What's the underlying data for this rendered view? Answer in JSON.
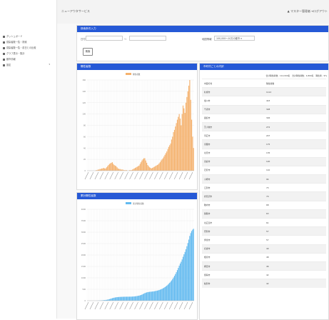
{
  "app": {
    "brand": "ニューアウタサービス",
    "user": "マスター管理者",
    "logout": "ログアウト"
  },
  "sidebar": {
    "items": [
      {
        "icon": "dashboard-icon",
        "label": "ダッシュボード"
      },
      {
        "icon": "file-icon",
        "label": "感染者数一覧・検索"
      },
      {
        "icon": "file-icon",
        "label": "感染者数一覧・前日との比較"
      },
      {
        "icon": "chart-icon",
        "label": "グラフ表示・集計"
      },
      {
        "icon": "list-icon",
        "label": "都市情報"
      },
      {
        "icon": "gear-icon",
        "label": "設定"
      }
    ]
  },
  "search": {
    "title": "検索条件入力",
    "date_label": "日付",
    "range_sep": "〜",
    "filter_label": "地図情報",
    "filter_value": "100,000～10万の都市",
    "search_button": "検索"
  },
  "chart1": {
    "title": "陽性者数",
    "legend": "陽性者数"
  },
  "chart2": {
    "title": "累計陽性者数",
    "legend": "累計陽性者数"
  },
  "city_panel": {
    "title": "市町村ごとの内訳",
    "summary": "合計陽性者数：112,000名　合計陽性者数：4,800名　陽性率：9%",
    "header_city": "市区町村",
    "header_count": "陽性者数",
    "rows": [
      {
        "city": "札幌市",
        "count": "1112"
      },
      {
        "city": "旭川市",
        "count": "443"
      },
      {
        "city": "千歳市",
        "count": "328"
      },
      {
        "city": "函館市",
        "count": "326"
      },
      {
        "city": "苫小牧市",
        "count": "272"
      },
      {
        "city": "帯広市",
        "count": "247"
      },
      {
        "city": "室蘭市",
        "count": "175"
      },
      {
        "city": "北見市",
        "count": "135"
      },
      {
        "city": "恵庭市",
        "count": "120"
      },
      {
        "city": "石狩市",
        "count": "110"
      },
      {
        "city": "小樽市",
        "count": "94"
      },
      {
        "city": "江別市",
        "count": "73"
      },
      {
        "city": "岩見沢市",
        "count": "70"
      },
      {
        "city": "稚内市",
        "count": "68"
      },
      {
        "city": "釧路市",
        "count": "63"
      },
      {
        "city": "北広島市",
        "count": "61"
      },
      {
        "city": "登別市",
        "count": "57"
      },
      {
        "city": "伊達市",
        "count": "57"
      },
      {
        "city": "名寄市",
        "count": "49"
      },
      {
        "city": "根室市",
        "count": "48"
      },
      {
        "city": "網走市",
        "count": "46"
      },
      {
        "city": "留萌市",
        "count": "42"
      },
      {
        "city": "紋別市",
        "count": "42"
      }
    ]
  },
  "colors": {
    "header": "#2659d6",
    "bar_orange": "#f5b26e",
    "bar_blue": "#62baf0"
  },
  "chart_data": [
    {
      "type": "bar",
      "title": "陽性者数",
      "series": [
        {
          "name": "陽性者数",
          "values": [
            0,
            0,
            0,
            0,
            0,
            0,
            0,
            0,
            0,
            1,
            1,
            2,
            2,
            3,
            3,
            4,
            4,
            5,
            4,
            4,
            6,
            8,
            10,
            12,
            13,
            14,
            15,
            12,
            10,
            9,
            8,
            6,
            4,
            3,
            3,
            2,
            2,
            2,
            1,
            1,
            1,
            1,
            0,
            0,
            1,
            1,
            1,
            2,
            3,
            4,
            5,
            6,
            7,
            8,
            9,
            12,
            15,
            18,
            20,
            22,
            22,
            18,
            14,
            10,
            8,
            6,
            5,
            4,
            5,
            6,
            7,
            8,
            9,
            10,
            11,
            13,
            15,
            18,
            20,
            22,
            25,
            28,
            31,
            34,
            38,
            42,
            45,
            48,
            55,
            60,
            68,
            72,
            78,
            84,
            90,
            95,
            100,
            92,
            80,
            100,
            115,
            110,
            102,
            120,
            130,
            140,
            150,
            160,
            125,
            90,
            60,
            40
          ]
        }
      ],
      "ylim": [
        0,
        160
      ],
      "yticks": [
        "0",
        "20",
        "40",
        "60",
        "80",
        "100",
        "120",
        "140",
        "160"
      ]
    },
    {
      "type": "bar",
      "title": "累計陽性者数",
      "series": [
        {
          "name": "累計陽性者数",
          "values": [
            0,
            0,
            0,
            0,
            0,
            0,
            0,
            0,
            0,
            1,
            2,
            4,
            6,
            9,
            12,
            16,
            20,
            25,
            29,
            33,
            39,
            47,
            57,
            69,
            82,
            96,
            111,
            123,
            133,
            142,
            150,
            156,
            160,
            163,
            166,
            168,
            170,
            172,
            173,
            174,
            175,
            176,
            176,
            176,
            177,
            178,
            179,
            181,
            184,
            188,
            193,
            199,
            206,
            214,
            223,
            235,
            250,
            268,
            288,
            310,
            332,
            350,
            364,
            374,
            382,
            388,
            393,
            397,
            402,
            408,
            415,
            423,
            432,
            442,
            453,
            466,
            481,
            499,
            519,
            541,
            566,
            594,
            625,
            659,
            697,
            739,
            784,
            832,
            887,
            947,
            1015,
            1087,
            1165,
            1249,
            1339,
            1434,
            1534,
            1626,
            1706,
            1806,
            1921,
            2031,
            2133,
            2253,
            2383,
            2523,
            2673,
            2833,
            2958,
            3048,
            3108,
            3148
          ]
        }
      ],
      "ylim": [
        0,
        4000
      ],
      "yticks": [
        "0",
        "500",
        "1000",
        "1500",
        "2000",
        "2500",
        "3000",
        "3500",
        "4000"
      ]
    }
  ]
}
